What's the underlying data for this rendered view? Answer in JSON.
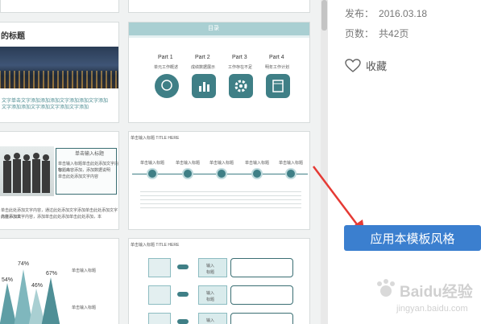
{
  "info": {
    "publish_label": "发布：",
    "publish_date": "2016.03.18",
    "pages_label": "页数：",
    "pages_value": "共42页",
    "favorite_label": "收藏"
  },
  "apply_button": "应用本模板风格",
  "watermark": {
    "brand": "Baidu经验",
    "url": "jingyan.baidu.com"
  },
  "slides": {
    "s1": {
      "title": "的标题",
      "caption_lines": [
        "文字单击文字添加添加添加文字添加添加文字添加",
        "文字添加添加文字添加文字添加文字添加"
      ]
    },
    "s2": {
      "title": "目录",
      "parts": [
        {
          "num": "Part 1",
          "label": "单元工作概述"
        },
        {
          "num": "Part 2",
          "label": "成绩数据展示"
        },
        {
          "num": "Part 3",
          "label": "工作存在不足"
        },
        {
          "num": "Part 4",
          "label": "明年工作计划"
        }
      ]
    },
    "s3": {
      "heading": "单击输入标题",
      "text_lines": [
        "单击输入标题单击此处添加文字内容，本",
        "标题内容添加，添加数据说明",
        "单击此处添加文字内容"
      ],
      "bottom_lines": [
        "单击此处添加文字内容，通过此处添加文字添加单击此处添加文字内容添加单",
        "此处添加文字内容，添加单击此处添加单击此处添加，本"
      ]
    },
    "s4": {
      "header": "单击输入标题 TITLE HERE",
      "items": [
        "单击输入标题",
        "单击输入标题",
        "单击输入标题",
        "单击输入标题",
        "单击输入标题"
      ]
    },
    "s5": {
      "pcts": [
        "74%",
        "54%",
        "46%",
        "67%"
      ],
      "labels": [
        "单击输入标题",
        "单击输入标题"
      ]
    },
    "s6": {
      "header": "单击输入标题 TITLE HERE",
      "rows": [
        {
          "label": "输入\n标题"
        },
        {
          "label": "输入\n标题"
        },
        {
          "label": "输入\n标题"
        }
      ]
    }
  }
}
